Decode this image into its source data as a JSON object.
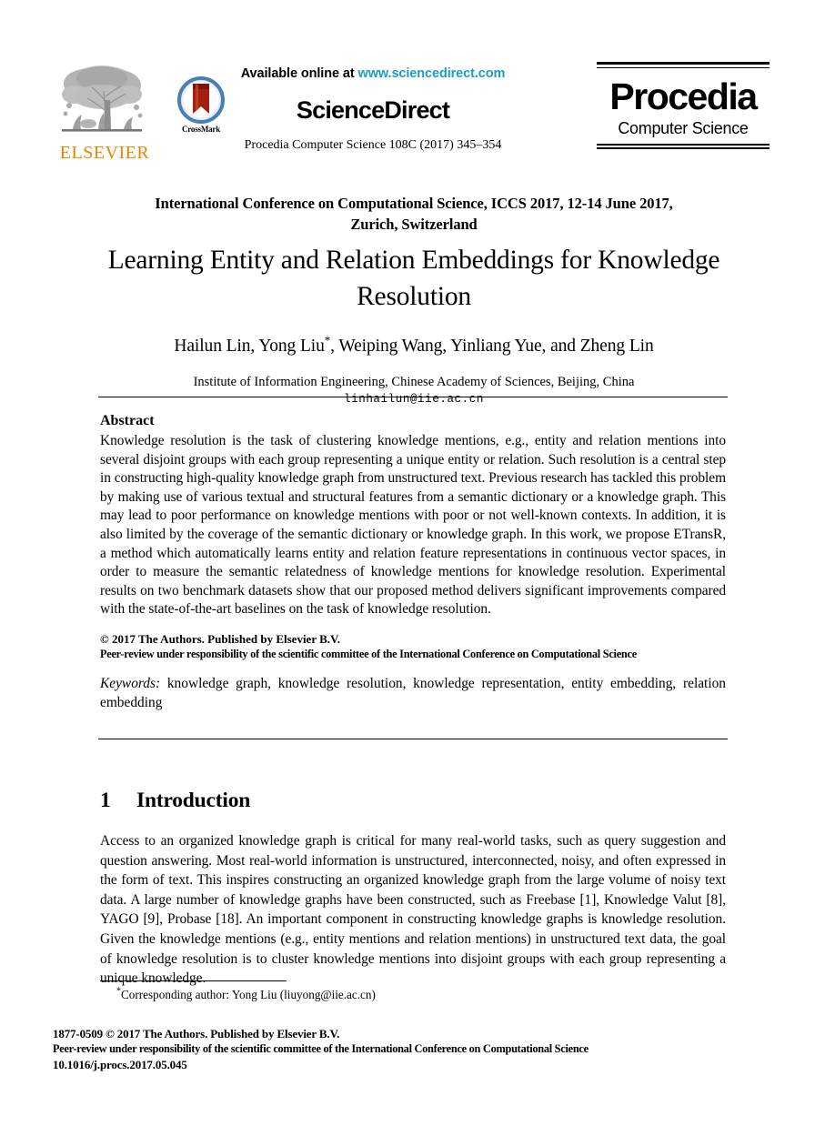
{
  "masthead": {
    "elsevier": {
      "wordmark": "ELSEVIER",
      "wordmark_color": "#ef8200",
      "tree_icon": "elsevier-tree-icon"
    },
    "crossmark": {
      "label": "CrossMark",
      "ring_color": "#4a7fb5",
      "ribbon_color": "#a31f12"
    },
    "sciencedirect": {
      "available_prefix": "Available online at ",
      "url": "www.sciencedirect.com",
      "url_color": "#1a9ec4",
      "brand": "ScienceDirect",
      "series_line": "Procedia Computer Science 108C (2017) 345–354"
    },
    "procedia": {
      "name": "Procedia",
      "subtitle": "Computer Science"
    }
  },
  "title_area": {
    "conference_line_1": "International Conference on Computational Science, ICCS 2017, 12-14 June 2017,",
    "conference_line_2": "Zurich, Switzerland",
    "paper_title": "Learning Entity and Relation Embeddings for Knowledge Resolution",
    "authors_part_1": "Hailun Lin, Yong Liu",
    "authors_marker": "*",
    "authors_part_2": ", Weiping Wang, Yinliang Yue, and Zheng Lin",
    "affiliation": "Institute of Information Engineering, Chinese Academy of Sciences, Beijing, China",
    "email": "linhailun@iie.ac.cn"
  },
  "abstract": {
    "heading": "Abstract",
    "body": "Knowledge resolution is the task of clustering knowledge mentions, e.g., entity and relation mentions into several disjoint groups with each group representing a unique entity or relation. Such resolution is a central step in constructing high-quality knowledge graph from unstructured text. Previous research has tackled this problem by making use of various textual and structural features from a semantic dictionary or a knowledge graph. This may lead to poor performance on knowledge mentions with poor or not well-known contexts. In addition, it is also limited by the coverage of the semantic dictionary or knowledge graph. In this work, we propose ETransR, a method which automatically learns entity and relation feature representations in continuous vector spaces, in order to measure the semantic relatedness of knowledge mentions for knowledge resolution. Experimental results on two benchmark datasets show that our proposed method delivers significant improvements compared with the state-of-the-art baselines on the task of knowledge resolution.",
    "copyright_line": "© 2017 The Authors. Published by Elsevier B.V.",
    "peerreview_line": "Peer-review under responsibility of the scientific committee of the International Conference on Computational Science",
    "keywords_label": "Keywords:",
    "keywords_value": " knowledge graph, knowledge resolution, knowledge representation, entity embedding, relation embedding"
  },
  "section_one": {
    "number": "1",
    "heading": "Introduction",
    "body": "Access to an organized knowledge graph is critical for many real-world tasks, such as query suggestion and question answering. Most real-world information is unstructured, interconnected, noisy, and often expressed in the form of text. This inspires constructing an organized knowledge graph from the large volume of noisy text data. A large number of knowledge graphs have been constructed, such as Freebase [1], Knowledge Valut [8], YAGO [9], Probase [18]. An important component in constructing knowledge graphs is knowledge resolution. Given the knowledge mentions (e.g., entity mentions and relation mentions) in unstructured text data, the goal of knowledge resolution is to cluster knowledge mentions into disjoint groups with each group representing a unique knowledge."
  },
  "footnote": {
    "marker": "*",
    "text": "Corresponding author: Yong Liu (liuyong@iie.ac.cn)"
  },
  "bottom_matter": {
    "issn_line": "1877-0509 © 2017 The Authors. Published by Elsevier B.V.",
    "peerreview_line": "Peer-review under responsibility of the scientific committee of the International Conference on Computational Science",
    "doi_line": "10.1016/j.procs.2017.05.045"
  }
}
